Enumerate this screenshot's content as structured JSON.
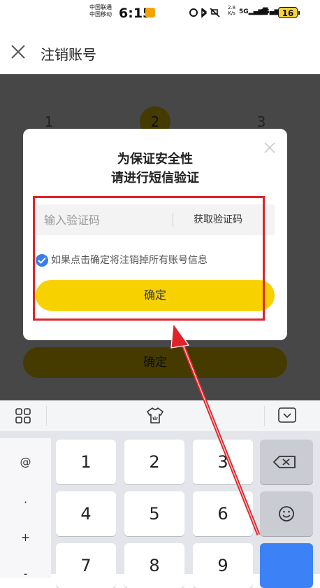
{
  "status_bar": {
    "carrier_1": "中国联通",
    "carrier_2": "中国移动",
    "time": "6:15",
    "net_speed": "2.8",
    "net_unit": "K/s",
    "signal_1": "5G",
    "signal_2": "4G",
    "battery": "16"
  },
  "header": {
    "close_icon": "close-icon",
    "title": "注销账号"
  },
  "background_page": {
    "steps": [
      "1",
      "2",
      "3"
    ],
    "active_step": "2",
    "confirm_label": "确定"
  },
  "dialog": {
    "title_line_1": "为保证安全性",
    "title_line_2": "请进行短信验证",
    "code_placeholder": "输入验证码",
    "get_code_label": "获取验证码",
    "checkbox_checked": true,
    "checkbox_label": "如果点击确定将注销掉所有账号信息",
    "confirm_label": "确定"
  },
  "annotation": {
    "box_color": "#e0232a",
    "arrow_color": "#e0232a"
  },
  "keyboard": {
    "toolbar_icons": [
      "grid-icon",
      "skin-icon",
      "keyboard-hide-icon"
    ],
    "symbols": [
      "@",
      "·",
      "+",
      "-"
    ],
    "keys": [
      "1",
      "2",
      "3",
      "4",
      "5",
      "6",
      "7",
      "8",
      "9"
    ],
    "function_icons": [
      "backspace-icon",
      "emoji-icon"
    ]
  },
  "colors": {
    "accent_yellow": "#f8d200",
    "check_blue": "#3a7ee8",
    "key_blue": "#3c82f6"
  }
}
